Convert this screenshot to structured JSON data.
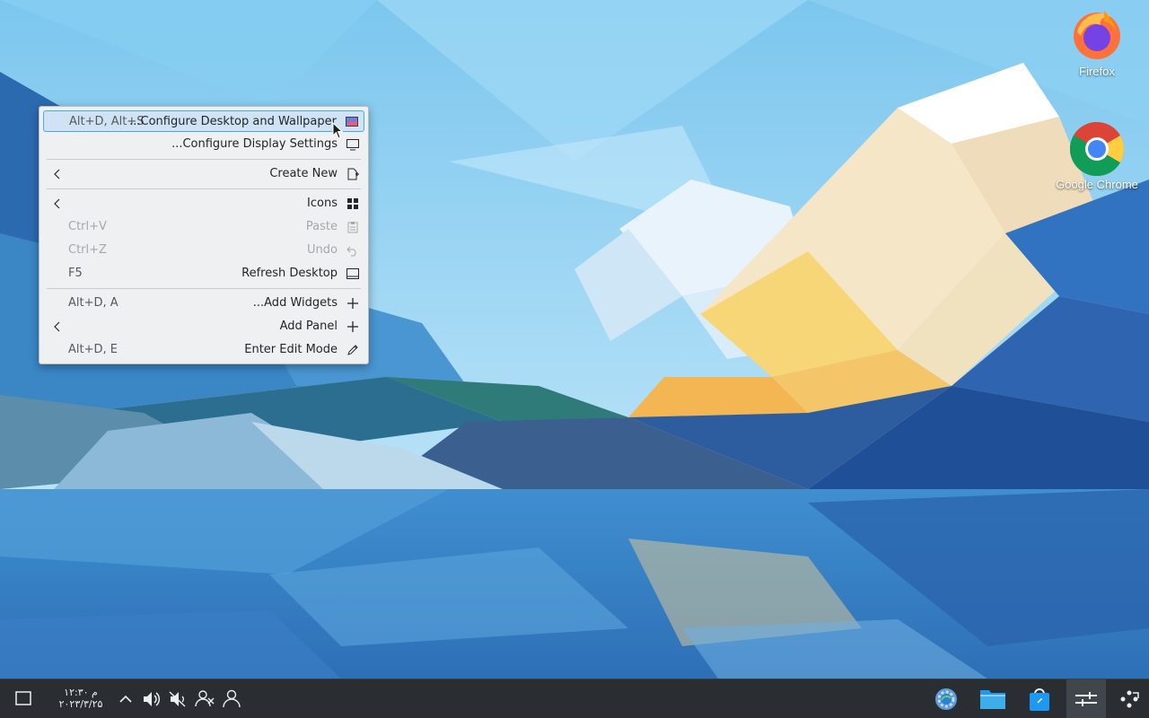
{
  "desktop": {
    "icons": [
      {
        "label": "Firefox"
      },
      {
        "label": "Google Chrome"
      }
    ]
  },
  "context_menu": {
    "items": [
      {
        "label": "...Configure Desktop and Wallpaper",
        "shortcut": "Alt+D, Alt+S",
        "icon": "wallpaper-icon",
        "highlighted": true,
        "enabled": true
      },
      {
        "label": "...Configure Display Settings",
        "shortcut": "",
        "icon": "display-icon",
        "enabled": true
      },
      {
        "label": "Create New",
        "shortcut": "",
        "icon": "new-document-icon",
        "submenu": true,
        "enabled": true
      },
      {
        "label": "Icons",
        "shortcut": "",
        "icon": "icons-grid-icon",
        "submenu": true,
        "enabled": true
      },
      {
        "label": "Paste",
        "shortcut": "Ctrl+V",
        "icon": "clipboard-icon",
        "enabled": false
      },
      {
        "label": "Undo",
        "shortcut": "Ctrl+Z",
        "icon": "undo-icon",
        "enabled": false
      },
      {
        "label": "Refresh Desktop",
        "shortcut": "F5",
        "icon": "refresh-desktop-icon",
        "enabled": true
      },
      {
        "label": "...Add Widgets",
        "shortcut": "Alt+D, A",
        "icon": "plus-icon",
        "enabled": true
      },
      {
        "label": "Add Panel",
        "shortcut": "",
        "icon": "plus-icon",
        "submenu": true,
        "enabled": true
      },
      {
        "label": "Enter Edit Mode",
        "shortcut": "Alt+D, E",
        "icon": "pencil-icon",
        "enabled": true
      }
    ]
  },
  "taskbar": {
    "clock_time": "۱۲:۳۰ م",
    "clock_date": "۲۰۲۳/۳/۲۵"
  },
  "colors": {
    "highlight": "#cfe3f5",
    "highlight_border": "#3daee9",
    "menu_bg": "#eff0f1",
    "panel_bg": "#2a2e32"
  }
}
